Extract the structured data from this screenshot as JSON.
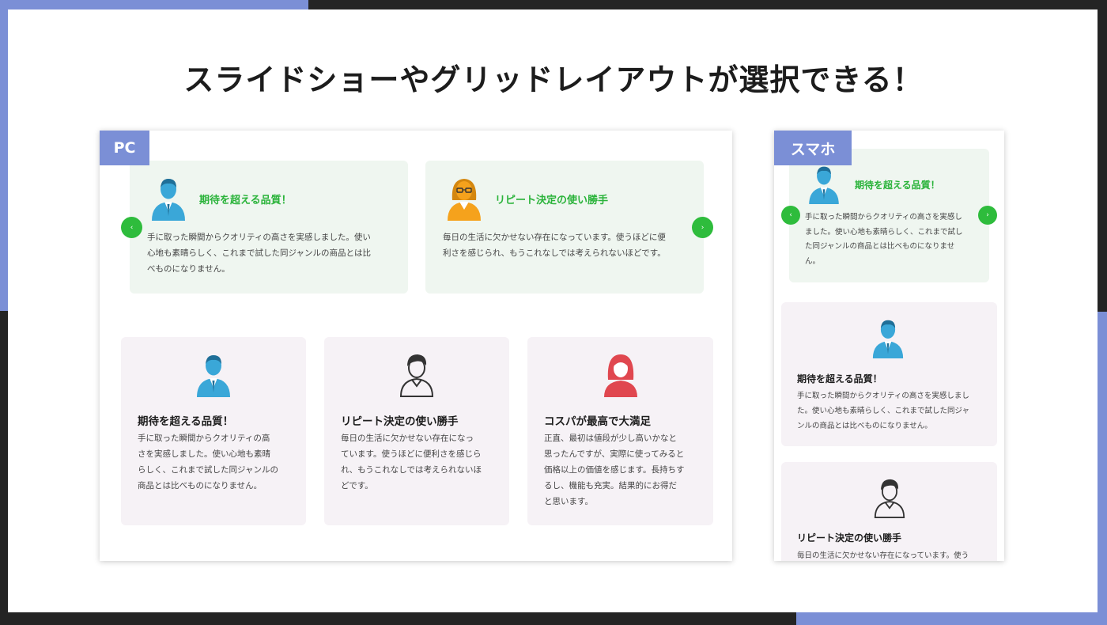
{
  "title": "スライドショーやグリッドレイアウトが選択できる！",
  "pc": {
    "tag": "PC",
    "slides": [
      {
        "title": "期待を超える品質！",
        "icon": "man-blue-icon",
        "text": [
          "手に取った瞬間からクオリティの高さを実感しました。使い",
          "心地も素晴らしく、これまで試した同ジャンルの商品とは比",
          "べものになりません。"
        ]
      },
      {
        "title": "リピート決定の使い勝手",
        "icon": "woman-glasses-orange-icon",
        "text": [
          "毎日の生活に欠かせない存在になっています。使うほどに便",
          "利さを感じられ、もうこれなしでは考えられないほどです。"
        ]
      }
    ],
    "prev_arrow": "‹",
    "next_arrow": "›",
    "cards": [
      {
        "title": "期待を超える品質！",
        "icon": "man-blue-icon",
        "text": [
          "手に取った瞬間からクオリティの高",
          "さを実感しました。使い心地も素晴",
          "らしく、これまで試した同ジャンルの",
          "商品とは比べものになりません。"
        ]
      },
      {
        "title": "リピート決定の使い勝手",
        "icon": "person-outline-icon",
        "text": [
          "毎日の生活に欠かせない存在になっ",
          "ています。使うほどに便利さを感じら",
          "れ、もうこれなしでは考えられないほ",
          "どです。"
        ]
      },
      {
        "title": "コスパが最高で大満足",
        "icon": "woman-red-icon",
        "text": [
          "正直、最初は値段が少し高いかなと",
          "思ったんですが、実際に使ってみると",
          "価格以上の価値を感じます。長持ちす",
          "るし、機能も充実。結果的にお得だ",
          "と思います。"
        ]
      }
    ]
  },
  "sp": {
    "tag": "スマホ",
    "slide": {
      "title": "期待を超える品質！",
      "icon": "man-blue-icon",
      "text": [
        "手に取った瞬間からクオリティの高さを実感し",
        "ました。使い心地も素晴らしく、これまで試し",
        "た同ジャンルの商品とは比べものになりませ",
        "ん。"
      ]
    },
    "prev_arrow": "‹",
    "next_arrow": "›",
    "cards": [
      {
        "title": "期待を超える品質！",
        "icon": "man-blue-icon",
        "text": [
          "手に取った瞬間からクオリティの高さを実感しまし",
          "た。使い心地も素晴らしく、これまで試した同ジャ",
          "ンルの商品とは比べものになりません。"
        ]
      },
      {
        "title": "リピート決定の使い勝手",
        "icon": "person-outline-icon",
        "text": [
          "毎日の生活に欠かせない存在になっています。使う"
        ]
      }
    ]
  },
  "colors": {
    "accent": "#7b8fd6",
    "green": "#2ebc3c",
    "blue_icon": "#3aa7d8",
    "orange_icon": "#f5a21c",
    "red_icon": "#e0474f"
  }
}
